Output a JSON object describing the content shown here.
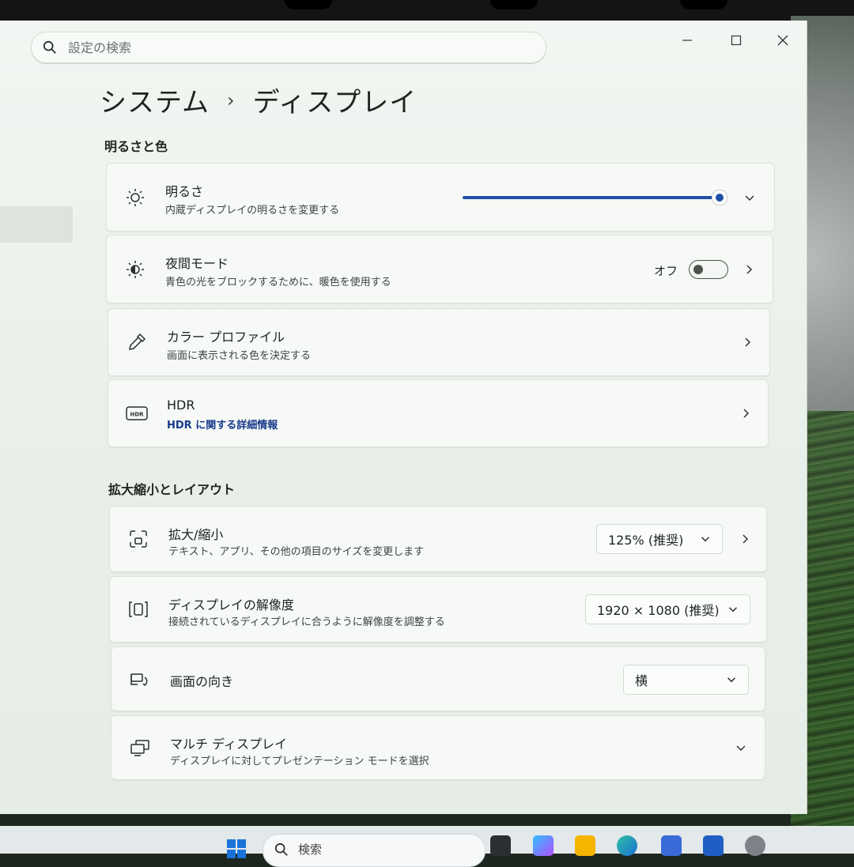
{
  "window": {
    "search_placeholder": "設定の検索",
    "controls": [
      "minimize",
      "maximize",
      "close"
    ]
  },
  "breadcrumb": {
    "parent": "システム",
    "separator": "›",
    "current": "ディスプレイ"
  },
  "sections": {
    "brightness_color": {
      "title": "明るさと色",
      "brightness": {
        "title": "明るさ",
        "desc": "内蔵ディスプレイの明るさを変更する",
        "level": 1.0
      },
      "night_mode": {
        "title": "夜間モード",
        "desc": "青色の光をブロックするために、暖色を使用する",
        "state": "オフ"
      },
      "color_profile": {
        "title": "カラー プロファイル",
        "desc": "画面に表示される色を決定する"
      },
      "hdr": {
        "title": "HDR",
        "link": "HDR に関する詳細情報"
      }
    },
    "scale_layout": {
      "title": "拡大縮小とレイアウト",
      "scale": {
        "title": "拡大/縮小",
        "desc": "テキスト、アプリ、その他の項目のサイズを変更します",
        "value": "125% (推奨)"
      },
      "resolution": {
        "title": "ディスプレイの解像度",
        "desc": "接続されているディスプレイに合うように解像度を調整する",
        "value": "1920 × 1080 (推奨)"
      },
      "orientation": {
        "title": "画面の向き",
        "value": "横"
      },
      "multi_display": {
        "title": "マルチ ディスプレイ",
        "desc": "ディスプレイに対してプレゼンテーション モードを選択"
      }
    }
  },
  "taskbar": {
    "search_label": "検索"
  },
  "colors": {
    "accent": "#1f4fa8",
    "link": "#173a8c"
  }
}
